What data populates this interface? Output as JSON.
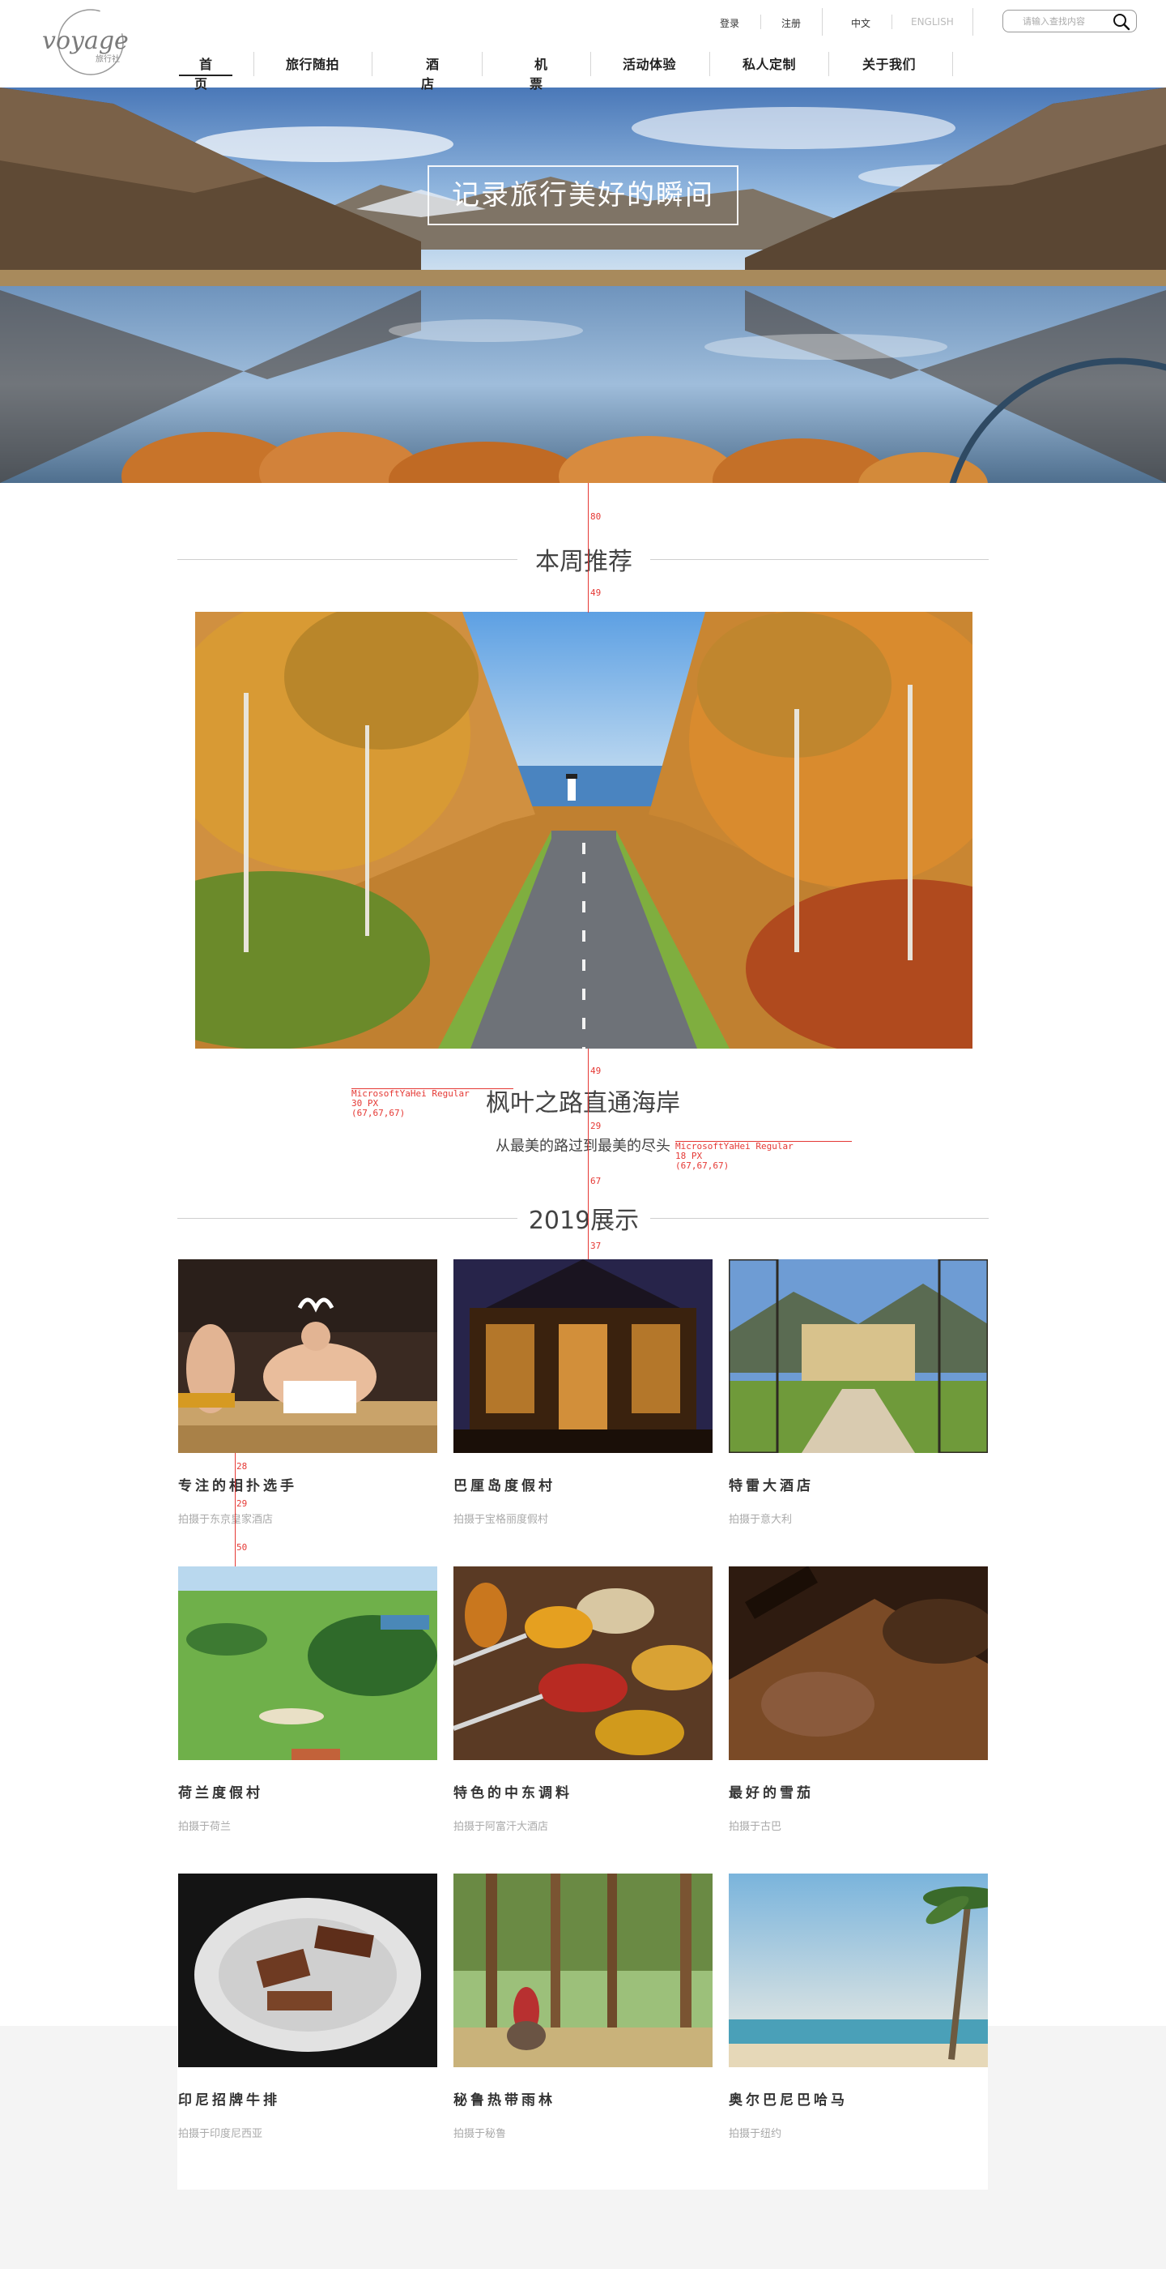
{
  "brand": {
    "logo_text": "voyage",
    "logo_sub": "旅行社"
  },
  "header": {
    "login": "登录",
    "register": "注册",
    "lang_zh": "中文",
    "lang_en": "ENGLISH",
    "search_placeholder": "请输入查找内容"
  },
  "nav": [
    {
      "label": "首 页",
      "active": true
    },
    {
      "label": "旅行随拍",
      "active": false
    },
    {
      "label": "酒 店",
      "active": false
    },
    {
      "label": "机 票",
      "active": false
    },
    {
      "label": "活动体验",
      "active": false
    },
    {
      "label": "私人定制",
      "active": false
    },
    {
      "label": "关于我们",
      "active": false
    }
  ],
  "hero": {
    "caption": "记录旅行美好的瞬间"
  },
  "weekly": {
    "heading": "本周推荐",
    "title": "枫叶之路直通海岸",
    "subtitle": "从最美的路过到最美的尽头"
  },
  "showcase": {
    "heading": "2019展示",
    "cards": [
      {
        "title": "专注的相扑选手",
        "subtitle": "拍摄于东京皇家酒店"
      },
      {
        "title": "巴厘岛度假村",
        "subtitle": "拍摄于宝格丽度假村"
      },
      {
        "title": "特雷大酒店",
        "subtitle": "拍摄于意大利"
      },
      {
        "title": "荷兰度假村",
        "subtitle": "拍摄于荷兰"
      },
      {
        "title": "特色的中东调料",
        "subtitle": "拍摄于阿富汗大酒店"
      },
      {
        "title": "最好的雪茄",
        "subtitle": "拍摄于古巴"
      },
      {
        "title": "印尼招牌牛排",
        "subtitle": "拍摄于印度尼西亚"
      },
      {
        "title": "秘鲁热带雨林",
        "subtitle": "拍摄于秘鲁"
      },
      {
        "title": "奥尔巴尼巴哈马",
        "subtitle": "拍摄于纽约"
      }
    ]
  },
  "annotations": {
    "a80": "80",
    "a49a": "49",
    "a49b": "49",
    "a29a": "29",
    "a67": "67",
    "a37": "37",
    "a28": "28",
    "a29b": "29",
    "a50": "50",
    "font_a": "MicrosoftYaHei Regular\n30 PX\n(67,67,67)",
    "font_b": "MicrosoftYaHei Regular\n18 PX\n(67,67,67)"
  }
}
